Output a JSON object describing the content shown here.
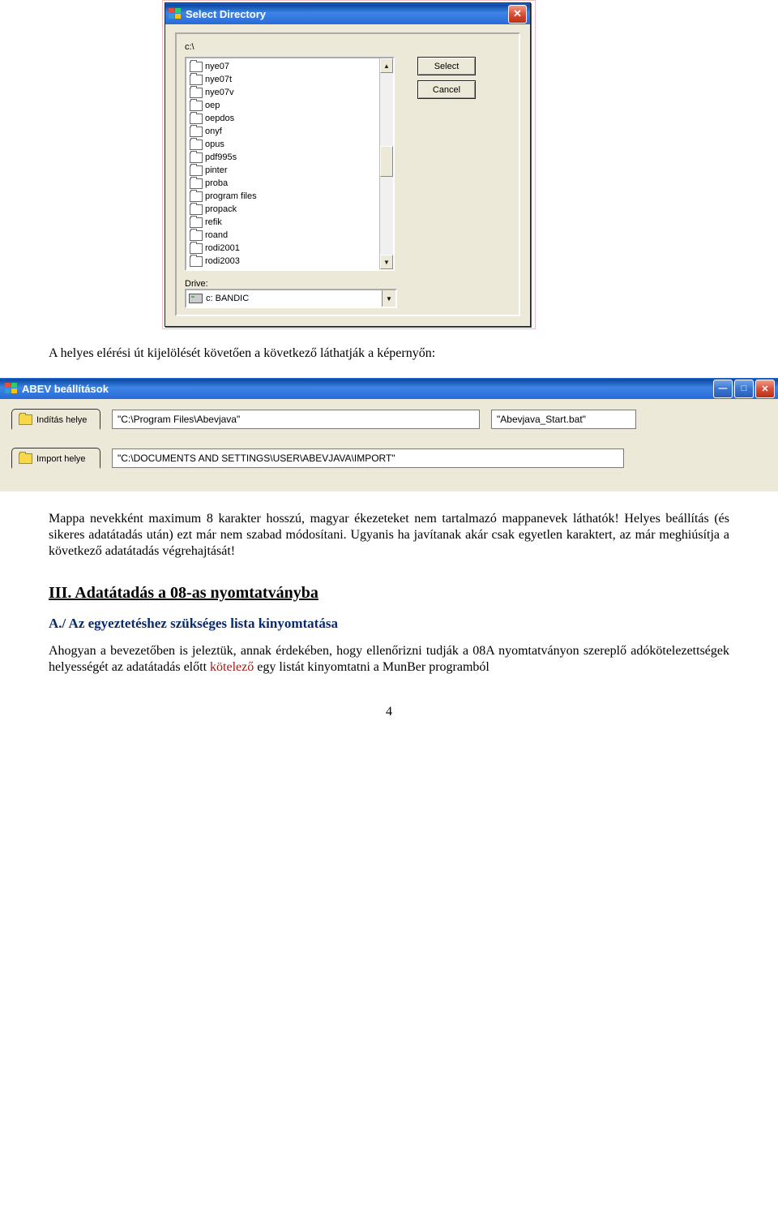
{
  "dialog1": {
    "title": "Select Directory",
    "path": "c:\\",
    "folders": [
      "nye07",
      "nye07t",
      "nye07v",
      "oep",
      "oepdos",
      "onyf",
      "opus",
      "pdf995s",
      "pinter",
      "proba",
      "program files",
      "propack",
      "refik",
      "roand",
      "rodi2001",
      "rodi2003"
    ],
    "select_btn": "Select",
    "cancel_btn": "Cancel",
    "drive_label": "Drive:",
    "drive_value": "c: BANDIC"
  },
  "para1": "A helyes elérési út kijelölését követően a következő láthatják a képernyőn:",
  "dialog2": {
    "title": "ABEV beállítások",
    "row1_label": "Indítás helye",
    "row1_path": "\"C:\\Program Files\\Abevjava\"",
    "row1_file": "\"Abevjava_Start.bat\"",
    "row2_label": "Import helye",
    "row2_path": "\"C:\\DOCUMENTS AND SETTINGS\\USER\\ABEVJAVA\\IMPORT\""
  },
  "para2": "Mappa nevekként maximum 8 karakter hosszú, magyar ékezeteket nem tartalmazó mappanevek láthatók! Helyes beállítás (és sikeres adatátadás után) ezt már nem szabad módosítani. Ugyanis ha javítanak akár csak egyetlen karaktert, az már meghiúsítja a következő adatátadás végrehajtását!",
  "section_title": "III. Adatátadás a 08-as nyomtatványba",
  "subsection_title": "A./ Az egyeztetéshez szükséges lista kinyomtatása",
  "para3a": "Ahogyan a bevezetőben is jeleztük, annak érdekében, hogy ellenőrizni tudják a 08A nyomtatványon szereplő adókötelezettségek helyességét az adatátadás előtt ",
  "para3_red": "kötelező",
  "para3b": " egy listát kinyomtatni a MunBer programból",
  "pagenum": "4"
}
